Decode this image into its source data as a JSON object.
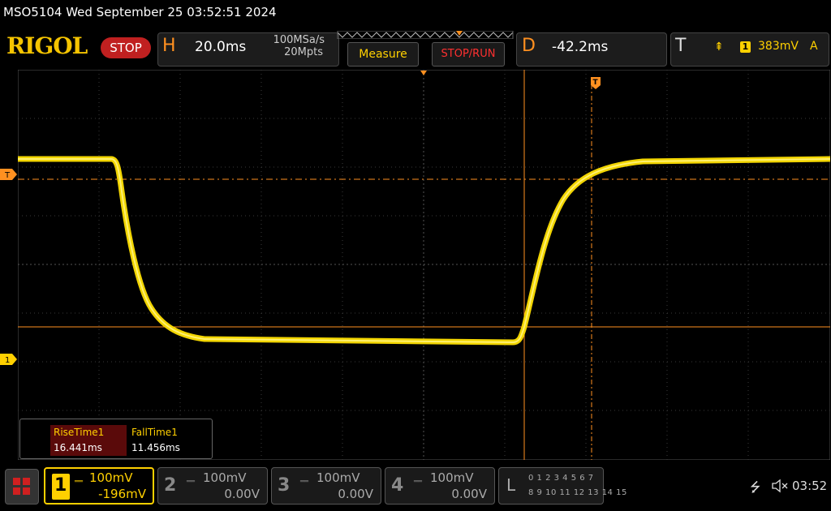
{
  "title": "MSO5104  Wed September 25 03:52:51 2024",
  "logo": "RIGOL",
  "run_status": "STOP",
  "horizontal": {
    "letter": "H",
    "timebase": "20.0ms",
    "sample_rate": "100MSa/s",
    "memory_depth": "20Mpts"
  },
  "buttons": {
    "measure": "Measure",
    "stop_run": "STOP/RUN"
  },
  "delay": {
    "letter": "D",
    "value": "-42.2ms"
  },
  "trigger": {
    "letter": "T",
    "edge_symbol": "⇞",
    "source": "1",
    "level": "383mV",
    "mode": "A"
  },
  "screen_markers": {
    "trigger_level": "T",
    "ch1_ground": "1",
    "trigger_position": "T"
  },
  "measurements": {
    "headers": [
      "RiseTime1",
      "FallTime1"
    ],
    "values": [
      "16.441ms",
      "11.456ms"
    ]
  },
  "channels": [
    {
      "num": "1",
      "scale": "100mV",
      "offset": "-196mV"
    },
    {
      "num": "2",
      "scale": "100mV",
      "offset": "0.00V"
    },
    {
      "num": "3",
      "scale": "100mV",
      "offset": "0.00V"
    },
    {
      "num": "4",
      "scale": "100mV",
      "offset": "0.00V"
    }
  ],
  "logic_analyzer": {
    "letter": "L",
    "row1": "0 1 2 3  4 5 6 7",
    "row2": "8 9 10 11 12 13 14 15"
  },
  "status": {
    "usb_icon": "usb-icon",
    "sound_icon": "sound-muted-icon",
    "clock": "03:52"
  },
  "colors": {
    "ch1": "#ffd000",
    "accent": "#ff9020",
    "stop": "#c02020",
    "cursor": "#ff9020"
  }
}
